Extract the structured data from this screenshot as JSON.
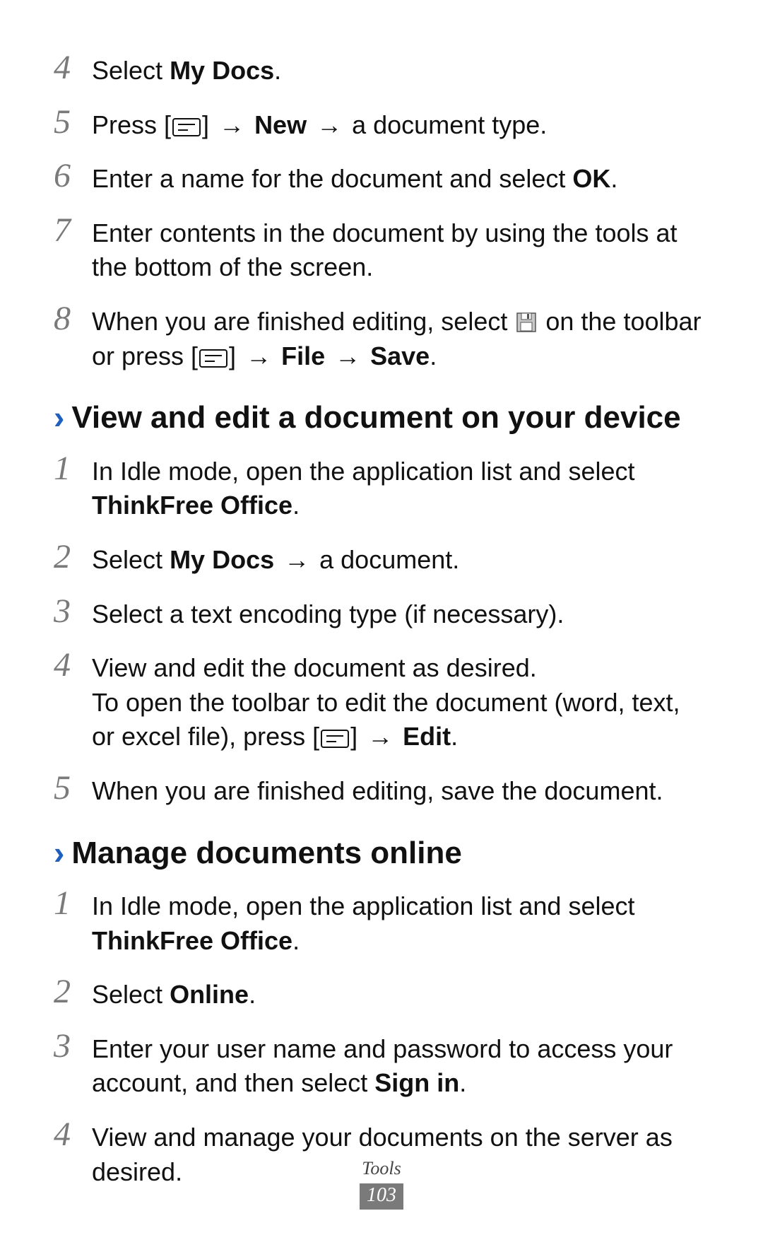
{
  "sections": {
    "initial_steps": [
      {
        "num": "4",
        "html": "Select <b>My Docs</b>."
      },
      {
        "num": "5",
        "html": "Press [__MENU__] <span class=\"arrow\">→</span> <b>New</b> <span class=\"arrow\">→</span> a document type."
      },
      {
        "num": "6",
        "html": "Enter a name for the document and select <b>OK</b>."
      },
      {
        "num": "7",
        "html": "Enter contents in the document by using the tools at the bottom of the screen."
      },
      {
        "num": "8",
        "html": "When you are finished editing, select __SAVE__ on the toolbar or press [__MENU__] <span class=\"arrow\">→</span> <b>File</b> <span class=\"arrow\">→</span> <b>Save</b>."
      }
    ],
    "view_edit": {
      "title": "View and edit a document on your device",
      "steps": [
        {
          "num": "1",
          "html": "In Idle mode, open the application list and select <b>ThinkFree Office</b>."
        },
        {
          "num": "2",
          "html": "Select <b>My Docs</b> <span class=\"arrow\">→</span> a document."
        },
        {
          "num": "3",
          "html": "Select a text encoding type (if necessary)."
        },
        {
          "num": "4",
          "html": "View and edit the document as desired.<br>To open the toolbar to edit the document (word, text, or excel file), press [__MENU__] <span class=\"arrow\">→</span> <b>Edit</b>."
        },
        {
          "num": "5",
          "html": "When you are finished editing, save the document."
        }
      ]
    },
    "manage_online": {
      "title": "Manage documents online",
      "steps": [
        {
          "num": "1",
          "html": "In Idle mode, open the application list and select <b>ThinkFree Office</b>."
        },
        {
          "num": "2",
          "html": "Select <b>Online</b>."
        },
        {
          "num": "3",
          "html": "Enter your user name and password to access your account, and then select <b>Sign in</b>."
        },
        {
          "num": "4",
          "html": "View and manage your documents on the server as desired."
        }
      ]
    }
  },
  "footer": {
    "section": "Tools",
    "page": "103"
  },
  "icons": {
    "menu_svg": "<svg class=\"inline-icon\" data-name=\"menu-icon\" data-interactable=\"false\" width=\"40\" height=\"26\" viewBox=\"0 0 40 26\"><rect x=\"1\" y=\"1\" width=\"38\" height=\"24\" rx=\"3\" fill=\"none\" stroke=\"#111\" stroke-width=\"2\"/><line x1=\"8\" y1=\"9\" x2=\"32\" y2=\"9\" stroke=\"#111\" stroke-width=\"2\"/><line x1=\"8\" y1=\"17\" x2=\"22\" y2=\"17\" stroke=\"#111\" stroke-width=\"2\"/></svg>",
    "save_svg": "<svg class=\"inline-icon\" data-name=\"save-icon\" data-interactable=\"false\" width=\"30\" height=\"30\" viewBox=\"0 0 30 30\"><rect x=\"2\" y=\"2\" width=\"26\" height=\"26\" fill=\"#c8c8c8\" stroke=\"#555\" stroke-width=\"1.5\"/><rect x=\"8\" y=\"2\" width=\"14\" height=\"9\" fill=\"#fff\" stroke=\"#555\" stroke-width=\"1\"/><rect x=\"16\" y=\"3\" width=\"3\" height=\"7\" fill=\"#555\"/><rect x=\"7\" y=\"15\" width=\"16\" height=\"12\" fill=\"#fff\" stroke=\"#555\" stroke-width=\"1\"/></svg>"
  }
}
